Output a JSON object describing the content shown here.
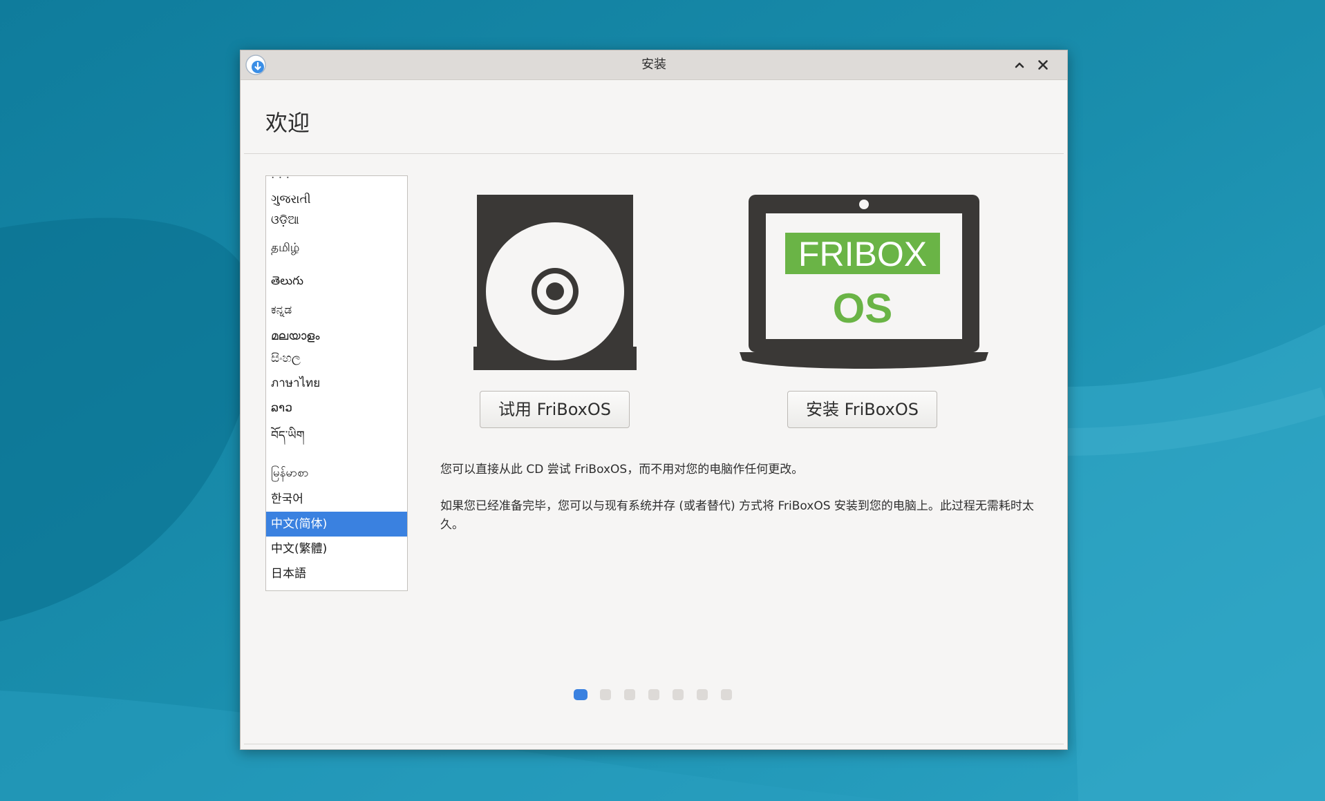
{
  "window": {
    "title": "安装"
  },
  "page": {
    "heading": "欢迎"
  },
  "languages": [
    {
      "label": "ગુજરાતી",
      "selected": false
    },
    {
      "label": "ଓଡ଼ିଆ",
      "selected": false
    },
    {
      "label": "தமிழ்",
      "selected": false
    },
    {
      "label": "తెలుగు",
      "selected": false
    },
    {
      "label": "ಕನ್ನಡ",
      "selected": false
    },
    {
      "label": "മലയാളം",
      "selected": false
    },
    {
      "label": "සිංහල",
      "selected": false
    },
    {
      "label": "ภาษาไทย",
      "selected": false
    },
    {
      "label": "ລາວ",
      "selected": false
    },
    {
      "label": "བོད་ཡིག",
      "selected": false
    },
    {
      "label": "မြန်မာစာ",
      "selected": false
    },
    {
      "label": "한국어",
      "selected": false
    },
    {
      "label": "中文(简体)",
      "selected": true
    },
    {
      "label": "中文(繁體)",
      "selected": false
    },
    {
      "label": "日本語",
      "selected": false
    }
  ],
  "media": {
    "laptop_logo_line1": "FRIBOX",
    "laptop_logo_line2": "OS"
  },
  "buttons": {
    "try_label": "试用 FriBoxOS",
    "install_label": "安装 FriBoxOS"
  },
  "descriptions": {
    "try_text": "您可以直接从此 CD 尝试 FriBoxOS，而不用对您的电脑作任何更改。",
    "install_text": "如果您已经准备完毕，您可以与现有系统并存 (或者替代) 方式将 FriBoxOS 安装到您的电脑上。此过程无需耗时太久。"
  },
  "progress": {
    "total_steps": 7,
    "current_step": 1
  },
  "colors": {
    "desktop_background": "#1c86a7",
    "accent": "#3a81e0",
    "logo_green": "#6ab446",
    "device_dark": "#3a3836"
  },
  "icons": {
    "app_icon": "installer-download-icon",
    "maximize": "chevron-up-icon",
    "close": "close-icon",
    "try_media": "cd-drive-icon",
    "install_media": "laptop-icon"
  }
}
